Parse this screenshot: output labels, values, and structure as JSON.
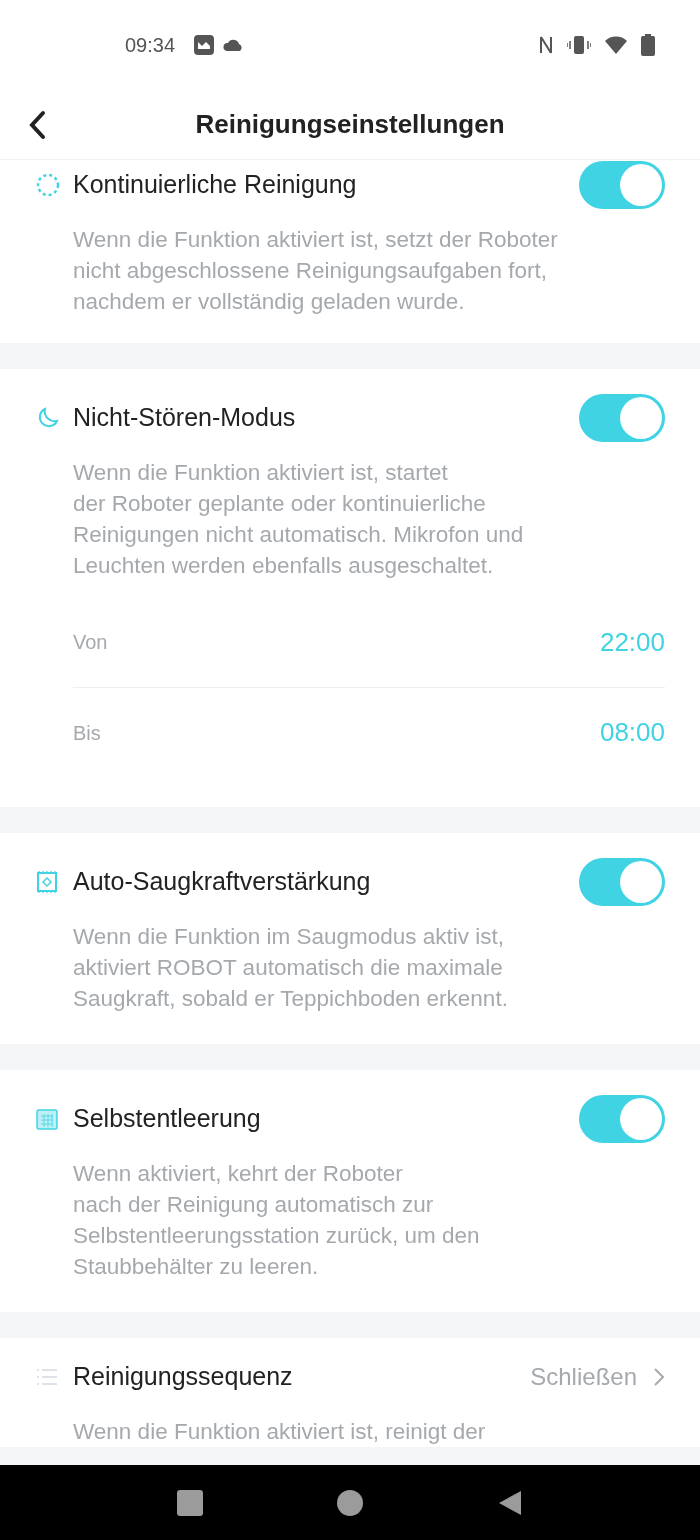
{
  "status_bar": {
    "time": "09:34"
  },
  "header": {
    "title": "Reinigungseinstellungen"
  },
  "sections": [
    {
      "kind": "toggle",
      "title": "Kontinuierliche Reinigung",
      "on": true,
      "description": "Wenn die Funktion aktiviert ist, setzt der Roboter\nnicht abgeschlossene Reinigungsaufgaben fort,\nnachdem er vollständig geladen wurde."
    },
    {
      "kind": "toggle",
      "title": "Nicht-Stören-Modus",
      "on": true,
      "description": "Wenn die Funktion aktiviert ist, startet\nder Roboter geplante oder kontinuierliche\nReinigungen nicht automatisch. Mikrofon und\nLeuchten werden ebenfalls ausgeschaltet.",
      "times": [
        {
          "label": "Von",
          "value": "22:00"
        },
        {
          "label": "Bis",
          "value": "08:00"
        }
      ]
    },
    {
      "kind": "toggle",
      "title": "Auto-Saugkraftverstärkung",
      "on": true,
      "description": "Wenn die Funktion im Saugmodus aktiv ist,\naktiviert ROBOT automatisch die maximale\nSaugkraft, sobald er Teppichboden erkennt."
    },
    {
      "kind": "toggle",
      "title": "Selbstentleerung",
      "on": true,
      "description": "Wenn aktiviert, kehrt der Roboter\nnach der Reinigung automatisch zur\nSelbstentleerungsstation zurück, um den\nStaubbehälter zu leeren."
    },
    {
      "kind": "link",
      "title": "Reinigungssequenz",
      "value": "Schließen",
      "description": "Wenn die Funktion aktiviert ist, reinigt der"
    }
  ]
}
